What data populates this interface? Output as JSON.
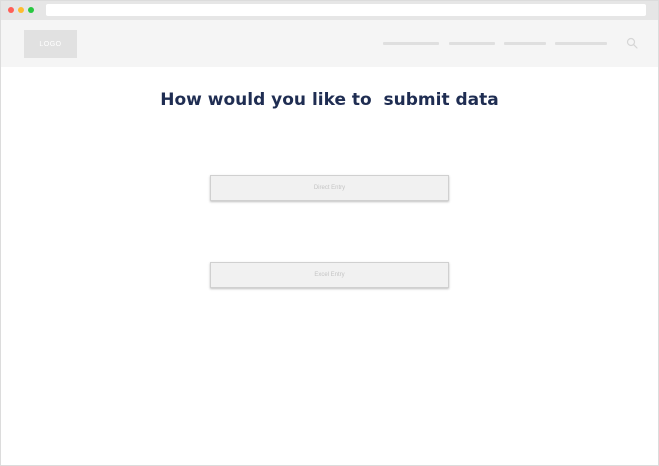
{
  "browser": {
    "controls": [
      "close-dot",
      "minimize-dot",
      "maximize-dot"
    ],
    "colors": {
      "close": "#ff5f57",
      "minimize": "#febc2e",
      "maximize": "#28c840"
    }
  },
  "nav": {
    "logo_text": "LOGO",
    "links": [
      "",
      "",
      "",
      ""
    ],
    "search_icon": "search-icon"
  },
  "main": {
    "title": "How would you like to  submit data",
    "title_color": "#1f2d52",
    "buttons": {
      "direct_entry": "Direct Entry",
      "excel_entry": "Excel Entry"
    }
  }
}
